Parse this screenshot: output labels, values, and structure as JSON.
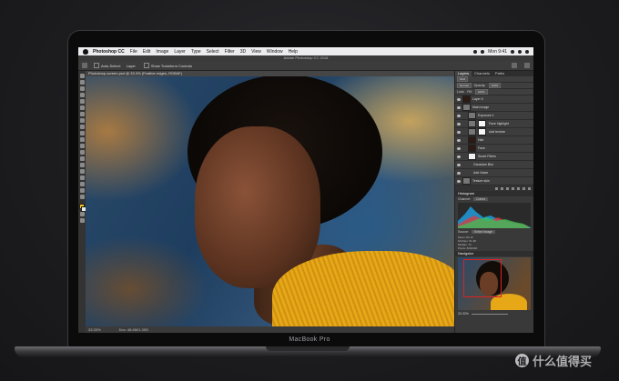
{
  "menubar": {
    "app": "Photoshop CC",
    "items": [
      "File",
      "Edit",
      "Image",
      "Layer",
      "Type",
      "Select",
      "Filter",
      "3D",
      "View",
      "Window",
      "Help"
    ],
    "clock": "Mon 9:41"
  },
  "window": {
    "title": "Adobe Photoshop CC 2018",
    "doc_tab": "Photoshop-screen.psd @ 33.3% (Feather edges, RGB/8*)"
  },
  "options_bar": {
    "auto_select": "Auto-Select:",
    "layer_dropdown": "Layer",
    "show_transform": "Show Transform Controls"
  },
  "canvas_status": {
    "zoom": "33.33%",
    "doc": "Doc: 48.6M/1.39G"
  },
  "layers_panel": {
    "tabs": [
      "Layers",
      "Channels",
      "Paths"
    ],
    "kind_label": "Kind",
    "blend_mode": "Normal",
    "opacity_label": "Opacity:",
    "opacity": "100%",
    "lock_label": "Lock:",
    "fill_label": "Fill:",
    "fill": "100%",
    "layers": [
      {
        "name": "Layer 0",
        "thumb": "dark",
        "selected": false
      },
      {
        "name": "Main image",
        "thumb": "group",
        "selected": false
      },
      {
        "name": "Exposure 1",
        "thumb": "gray",
        "selected": false
      },
      {
        "name": "Face highlight",
        "thumb": "white",
        "selected": false
      },
      {
        "name": "Add texture",
        "thumb": "white",
        "selected": false
      },
      {
        "name": "Hair",
        "thumb": "dark",
        "selected": false
      },
      {
        "name": "Face",
        "thumb": "dark",
        "selected": false
      },
      {
        "name": "Smart Filters",
        "thumb": "white",
        "selected": false
      },
      {
        "name": "Gaussian Blur",
        "thumb": "none",
        "selected": false
      },
      {
        "name": "Add Noise",
        "thumb": "none",
        "selected": false
      },
      {
        "name": "Texture skin",
        "thumb": "gray",
        "selected": false
      }
    ]
  },
  "histogram_panel": {
    "title": "Histogram",
    "channel_label": "Channel:",
    "channel": "Colors",
    "source_label": "Source:",
    "source": "Entire Image",
    "stats": [
      "Mean: 84.12",
      "Std Dev: 61.38",
      "Median: 72",
      "Pixels: 8294400"
    ]
  },
  "navigator_panel": {
    "title": "Navigator",
    "zoom": "33.33%"
  },
  "device": {
    "brand": "MacBook Pro"
  },
  "watermark": {
    "badge": "值",
    "text": "什么值得买"
  }
}
